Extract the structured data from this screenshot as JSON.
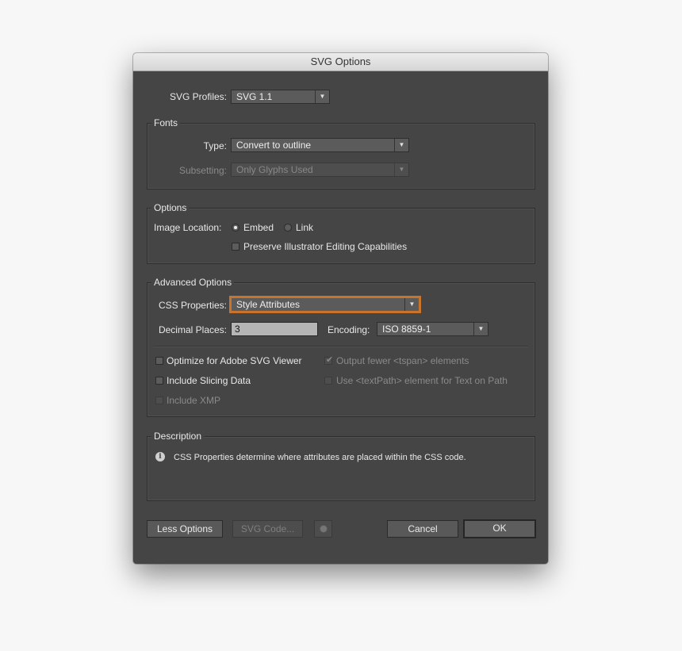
{
  "window": {
    "title": "SVG Options"
  },
  "svg_profiles": {
    "label": "SVG Profiles:",
    "value": "SVG 1.1"
  },
  "fonts": {
    "title": "Fonts",
    "type_label": "Type:",
    "type_value": "Convert to outline",
    "subsetting_label": "Subsetting:",
    "subsetting_value": "Only Glyphs Used"
  },
  "options": {
    "title": "Options",
    "image_location_label": "Image Location:",
    "embed_label": "Embed",
    "embed_selected": true,
    "link_label": "Link",
    "preserve_label": "Preserve Illustrator Editing Capabilities",
    "preserve_checked": false
  },
  "advanced": {
    "title": "Advanced Options",
    "css_label": "CSS Properties:",
    "css_value": "Style Attributes",
    "decimal_label": "Decimal Places:",
    "decimal_value": "3",
    "encoding_label": "Encoding:",
    "encoding_value": "ISO 8859-1",
    "optimize_label": "Optimize for Adobe SVG Viewer",
    "optimize_checked": false,
    "slicing_label": "Include Slicing Data",
    "slicing_checked": false,
    "xmp_label": "Include XMP",
    "xmp_checked": false,
    "tspan_label": "Output fewer <tspan> elements",
    "tspan_checked": true,
    "textpath_label": "Use <textPath> element for Text on Path",
    "textpath_checked": false
  },
  "description": {
    "title": "Description",
    "text": "CSS Properties determine where attributes are placed within the CSS code."
  },
  "buttons": {
    "less_options": "Less Options",
    "svg_code": "SVG Code...",
    "cancel": "Cancel",
    "ok": "OK"
  },
  "colors": {
    "dialog_bg": "#454545",
    "focus_ring": "#c9742d",
    "page_bg": "#f7f7f7"
  }
}
